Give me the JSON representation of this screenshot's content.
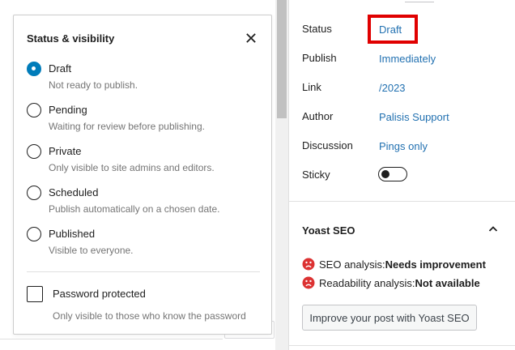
{
  "popover": {
    "title": "Status & visibility",
    "options": [
      {
        "label": "Draft",
        "description": "Not ready to publish.",
        "checked": true
      },
      {
        "label": "Pending",
        "description": "Waiting for review before publishing.",
        "checked": false
      },
      {
        "label": "Private",
        "description": "Only visible to site admins and editors.",
        "checked": false
      },
      {
        "label": "Scheduled",
        "description": "Publish automatically on a chosen date.",
        "checked": false
      },
      {
        "label": "Published",
        "description": "Visible to everyone.",
        "checked": false
      }
    ],
    "password": {
      "label": "Password protected",
      "description": "Only visible to those who know the password",
      "checked": false
    }
  },
  "summary": {
    "rows": [
      {
        "label": "Status",
        "value": "Draft"
      },
      {
        "label": "Publish",
        "value": "Immediately"
      },
      {
        "label": "Link",
        "value": "/2023"
      },
      {
        "label": "Author",
        "value": "Palisis Support"
      },
      {
        "label": "Discussion",
        "value": "Pings only"
      },
      {
        "label": "Sticky",
        "value": ""
      }
    ],
    "sticky_on": false
  },
  "yoast": {
    "title": "Yoast SEO",
    "seo_label": "SEO analysis: ",
    "seo_value": "Needs improvement",
    "readability_label": "Readability analysis: ",
    "readability_value": "Not available",
    "button_label": "Improve your post with Yoast SEO"
  },
  "colors": {
    "accent": "#007cba",
    "link": "#2271b1",
    "highlight": "#e00000",
    "sad": "#dc3232"
  }
}
